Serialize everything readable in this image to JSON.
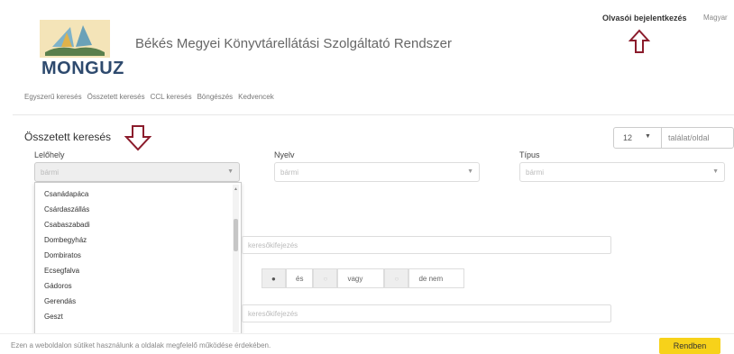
{
  "header": {
    "logo_text": "MONGUZ",
    "site_title": "Békés Megyei Könyvtárellátási Szolgáltató Rendszer",
    "login_link": "Olvasói bejelentkezés",
    "language": "Magyar"
  },
  "nav": {
    "items": [
      "Egyszerű keresés",
      "Összetett keresés",
      "CCL keresés",
      "Böngészés",
      "Kedvencek"
    ]
  },
  "form": {
    "title": "Összetett keresés",
    "per_page": {
      "value": "12",
      "label": "találat/oldal"
    },
    "location": {
      "label": "Lelőhely",
      "value": "bármi"
    },
    "language": {
      "label": "Nyelv",
      "value": "bármi"
    },
    "type": {
      "label": "Típus",
      "value": "bármi"
    },
    "dropdown_options": [
      "Csanádapáca",
      "Csárdaszállás",
      "Csabaszabadi",
      "Dombegyház",
      "Dombiratos",
      "Ecsegfalva",
      "Gádoros",
      "Gerendás",
      "Geszt"
    ],
    "search_placeholder_1": "keresőkifejezés",
    "search_placeholder_2": "keresőkifejezés",
    "operators": [
      "és",
      "vagy",
      "de nem"
    ]
  },
  "cookie": {
    "text": "Ezen a weboldalon sütiket használunk a oldalak megfelelő működése érdekében.",
    "button": "Rendben"
  },
  "colors": {
    "accent_arrow": "#8b1c2c",
    "cookie_button": "#f7d21a",
    "logo": "#2e4a6e"
  }
}
